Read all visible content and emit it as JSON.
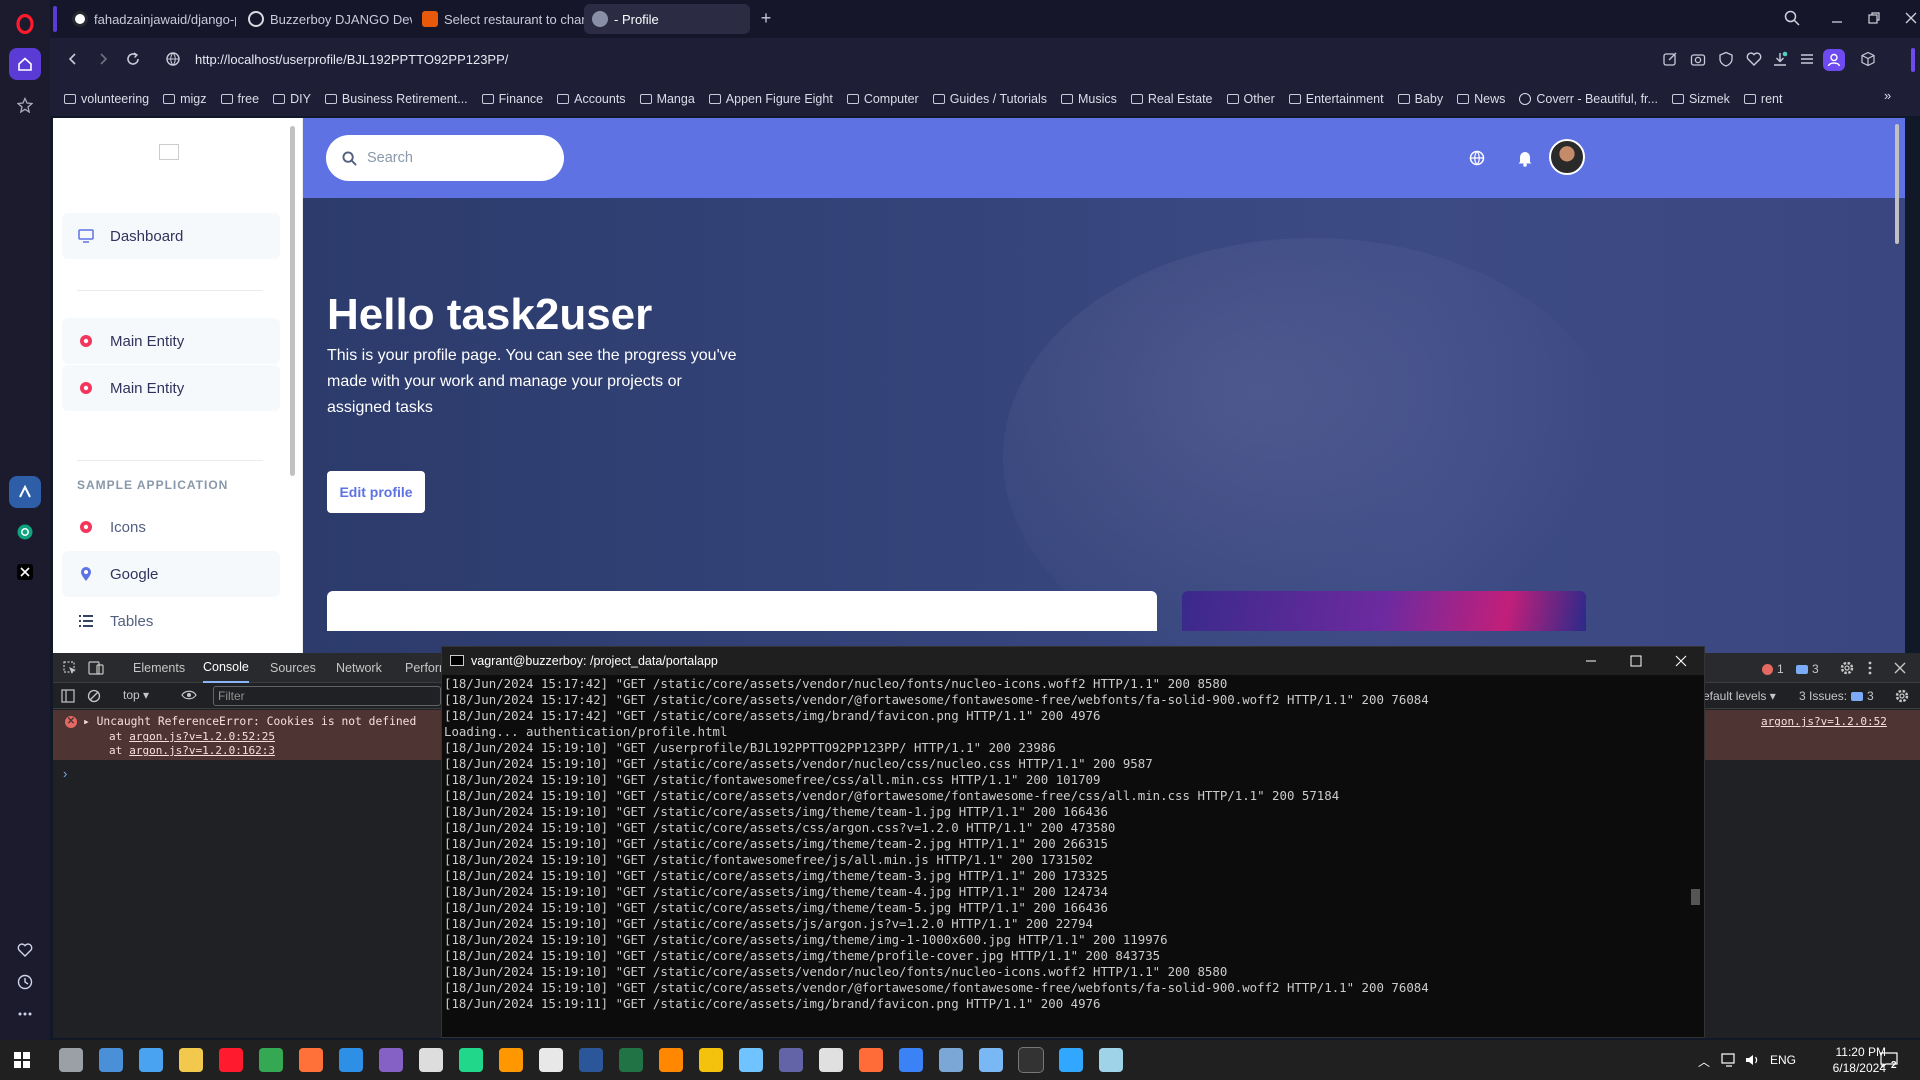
{
  "browser": {
    "tabs": [
      {
        "label": "fahadzainjawaid/django-p",
        "icon": "github-icon",
        "color": "#24292e"
      },
      {
        "label": "Buzzerboy DJANGO Devel",
        "icon": "globe-icon",
        "color": "#5f6368"
      },
      {
        "label": "Select restaurant to chang",
        "icon": "django-icon",
        "color": "#e8590c"
      },
      {
        "label": "- Profile",
        "icon": "avatar-icon",
        "color": "#8a8fa8"
      }
    ],
    "url": "http://localhost/userprofile/BJL192PPTTO92PP123PP/",
    "bookmarks": [
      {
        "label": "volunteering",
        "icon": "folder-icon"
      },
      {
        "label": "migz",
        "icon": "folder-icon"
      },
      {
        "label": "free",
        "icon": "folder-icon"
      },
      {
        "label": "DIY",
        "icon": "folder-icon"
      },
      {
        "label": "Business Retirement...",
        "icon": "folder-icon"
      },
      {
        "label": "Finance",
        "icon": "folder-icon"
      },
      {
        "label": "Accounts",
        "icon": "folder-icon"
      },
      {
        "label": "Manga",
        "icon": "folder-icon"
      },
      {
        "label": "Appen Figure Eight",
        "icon": "folder-icon"
      },
      {
        "label": "Computer",
        "icon": "folder-icon"
      },
      {
        "label": "Guides / Tutorials",
        "icon": "folder-icon"
      },
      {
        "label": "Musics",
        "icon": "folder-icon"
      },
      {
        "label": "Real Estate",
        "icon": "folder-icon"
      },
      {
        "label": "Other",
        "icon": "folder-icon"
      },
      {
        "label": "Entertainment",
        "icon": "folder-icon"
      },
      {
        "label": "Baby",
        "icon": "folder-icon"
      },
      {
        "label": "News",
        "icon": "folder-icon"
      },
      {
        "label": "Coverr - Beautiful, fr...",
        "icon": "site-icon"
      },
      {
        "label": "Sizmek",
        "icon": "folder-icon"
      },
      {
        "label": "rent",
        "icon": "folder-icon"
      }
    ]
  },
  "page": {
    "sidebar": {
      "items": [
        {
          "label": "Dashboard",
          "icon": "tv-icon",
          "color": "#5e72e4"
        },
        {
          "label": "Main Entity",
          "icon": "entity-icon",
          "color": "#f5365c"
        },
        {
          "label": "Main Entity",
          "icon": "entity-icon",
          "color": "#f5365c"
        }
      ],
      "section_heading": "SAMPLE APPLICATION",
      "sample_items": [
        {
          "label": "Icons",
          "icon": "entity-icon",
          "color": "#f5365c"
        },
        {
          "label": "Google",
          "icon": "pin-icon",
          "color": "#5e72e4"
        },
        {
          "label": "Tables",
          "icon": "list-icon",
          "color": "#172b4d"
        }
      ]
    },
    "search_placeholder": "Search",
    "hero": {
      "title": "Hello task2user",
      "body": "This is your profile page. You can see the progress you've made with your work and manage your projects or assigned tasks",
      "button": "Edit profile"
    },
    "accent": "#5e72e4"
  },
  "devtools": {
    "tabs": [
      "Elements",
      "Console",
      "Sources",
      "Network",
      "Perforr"
    ],
    "context": "top",
    "filter_placeholder": "Filter",
    "error_count": "1",
    "message_count": "3",
    "levels": "efault levels",
    "issues_label": "3 Issues:",
    "issues_count": "3",
    "error": {
      "message": "Uncaught ReferenceError: Cookies is not defined",
      "at1": "at",
      "link1": "argon.js?v=1.2.0:52:25",
      "at2": "at",
      "link2": "argon.js?v=1.2.0:162:3",
      "right_link": "argon.js?v=1.2.0:52"
    }
  },
  "terminal": {
    "title": "vagrant@buzzerboy: /project_data/portalapp",
    "lines": [
      "[18/Jun/2024 15:17:42] \"GET /static/core/assets/vendor/nucleo/fonts/nucleo-icons.woff2 HTTP/1.1\" 200 8580",
      "[18/Jun/2024 15:17:42] \"GET /static/core/assets/vendor/@fortawesome/fontawesome-free/webfonts/fa-solid-900.woff2 HTTP/1.1\" 200 76084",
      "[18/Jun/2024 15:17:42] \"GET /static/core/assets/img/brand/favicon.png HTTP/1.1\" 200 4976",
      "Loading... authentication/profile.html",
      "[18/Jun/2024 15:19:10] \"GET /userprofile/BJL192PPTTO92PP123PP/ HTTP/1.1\" 200 23986",
      "[18/Jun/2024 15:19:10] \"GET /static/core/assets/vendor/nucleo/css/nucleo.css HTTP/1.1\" 200 9587",
      "[18/Jun/2024 15:19:10] \"GET /static/fontawesomefree/css/all.min.css HTTP/1.1\" 200 101709",
      "[18/Jun/2024 15:19:10] \"GET /static/core/assets/vendor/@fortawesome/fontawesome-free/css/all.min.css HTTP/1.1\" 200 57184",
      "[18/Jun/2024 15:19:10] \"GET /static/core/assets/img/theme/team-1.jpg HTTP/1.1\" 200 166436",
      "[18/Jun/2024 15:19:10] \"GET /static/core/assets/css/argon.css?v=1.2.0 HTTP/1.1\" 200 473580",
      "[18/Jun/2024 15:19:10] \"GET /static/core/assets/img/theme/team-2.jpg HTTP/1.1\" 200 266315",
      "[18/Jun/2024 15:19:10] \"GET /static/fontawesomefree/js/all.min.js HTTP/1.1\" 200 1731502",
      "[18/Jun/2024 15:19:10] \"GET /static/core/assets/img/theme/team-3.jpg HTTP/1.1\" 200 173325",
      "[18/Jun/2024 15:19:10] \"GET /static/core/assets/img/theme/team-4.jpg HTTP/1.1\" 200 124734",
      "[18/Jun/2024 15:19:10] \"GET /static/core/assets/img/theme/team-5.jpg HTTP/1.1\" 200 166436",
      "[18/Jun/2024 15:19:10] \"GET /static/core/assets/js/argon.js?v=1.2.0 HTTP/1.1\" 200 22794",
      "[18/Jun/2024 15:19:10] \"GET /static/core/assets/img/theme/img-1-1000x600.jpg HTTP/1.1\" 200 119976",
      "[18/Jun/2024 15:19:10] \"GET /static/core/assets/img/theme/profile-cover.jpg HTTP/1.1\" 200 843735",
      "[18/Jun/2024 15:19:10] \"GET /static/core/assets/vendor/nucleo/fonts/nucleo-icons.woff2 HTTP/1.1\" 200 8580",
      "[18/Jun/2024 15:19:10] \"GET /static/core/assets/vendor/@fortawesome/fontawesome-free/webfonts/fa-solid-900.woff2 HTTP/1.1\" 200 76084",
      "[18/Jun/2024 15:19:11] \"GET /static/core/assets/img/brand/favicon.png HTTP/1.1\" 200 4976"
    ]
  },
  "taskbar": {
    "language": "ENG",
    "time": "11:20 PM",
    "date": "6/18/2024",
    "notification_count": "2",
    "apps": [
      {
        "name": "task-view-icon",
        "color": "#9aa0a6"
      },
      {
        "name": "widget-icon",
        "color": "#4a90d9"
      },
      {
        "name": "pen-icon",
        "color": "#4aa3f0"
      },
      {
        "name": "file-explorer-icon",
        "color": "#f2c94c"
      },
      {
        "name": "opera-icon",
        "color": "#ff1b2d"
      },
      {
        "name": "chrome-icon",
        "color": "#34a853"
      },
      {
        "name": "firefox-icon",
        "color": "#ff7139"
      },
      {
        "name": "vscode-icon",
        "color": "#2d8fe5"
      },
      {
        "name": "visual-studio-icon",
        "color": "#8661c5"
      },
      {
        "name": "unity-icon",
        "color": "#dddddd"
      },
      {
        "name": "pycharm-icon",
        "color": "#21d789"
      },
      {
        "name": "sublime-icon",
        "color": "#ff9800"
      },
      {
        "name": "cursor-icon",
        "color": "#e8e8e8"
      },
      {
        "name": "word-icon",
        "color": "#2b579a"
      },
      {
        "name": "excel-icon",
        "color": "#217346"
      },
      {
        "name": "vlc-icon",
        "color": "#ff8800"
      },
      {
        "name": "bolt-icon",
        "color": "#f4c20d"
      },
      {
        "name": "app-icon",
        "color": "#6fc3ff"
      },
      {
        "name": "teams-icon",
        "color": "#6264a7"
      },
      {
        "name": "notes-icon",
        "color": "#e0e0e0"
      },
      {
        "name": "postman-icon",
        "color": "#ff6c37"
      },
      {
        "name": "globe-app-icon",
        "color": "#3b82f6"
      },
      {
        "name": "monitor-icon",
        "color": "#7aa7d6"
      },
      {
        "name": "virtualbox-icon",
        "color": "#7ab8f5"
      },
      {
        "name": "terminal-icon",
        "color": "#333333"
      },
      {
        "name": "photoshop-icon",
        "color": "#31a8ff"
      },
      {
        "name": "sticky-icon",
        "color": "#9fd3e8"
      }
    ]
  }
}
